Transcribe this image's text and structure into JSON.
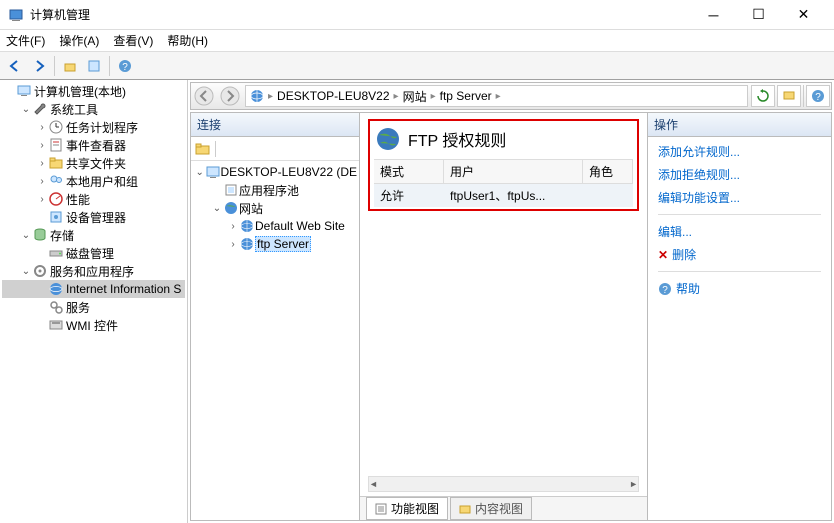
{
  "window": {
    "title": "计算机管理"
  },
  "menubar": [
    "文件(F)",
    "操作(A)",
    "查看(V)",
    "帮助(H)"
  ],
  "left_tree": [
    {
      "level": 0,
      "exp": "",
      "icon": "computer",
      "label": "计算机管理(本地)",
      "sel": false
    },
    {
      "level": 1,
      "exp": "v",
      "icon": "wrench",
      "label": "系统工具",
      "sel": false
    },
    {
      "level": 2,
      "exp": ">",
      "icon": "task",
      "label": "任务计划程序",
      "sel": false
    },
    {
      "level": 2,
      "exp": ">",
      "icon": "event",
      "label": "事件查看器",
      "sel": false
    },
    {
      "level": 2,
      "exp": ">",
      "icon": "share",
      "label": "共享文件夹",
      "sel": false
    },
    {
      "level": 2,
      "exp": ">",
      "icon": "users",
      "label": "本地用户和组",
      "sel": false
    },
    {
      "level": 2,
      "exp": ">",
      "icon": "perf",
      "label": "性能",
      "sel": false
    },
    {
      "level": 2,
      "exp": "",
      "icon": "device",
      "label": "设备管理器",
      "sel": false
    },
    {
      "level": 1,
      "exp": "v",
      "icon": "storage",
      "label": "存储",
      "sel": false
    },
    {
      "level": 2,
      "exp": "",
      "icon": "disk",
      "label": "磁盘管理",
      "sel": false
    },
    {
      "level": 1,
      "exp": "v",
      "icon": "services",
      "label": "服务和应用程序",
      "sel": false
    },
    {
      "level": 2,
      "exp": "",
      "icon": "iis",
      "label": "Internet Information S",
      "sel": true
    },
    {
      "level": 2,
      "exp": "",
      "icon": "svc",
      "label": "服务",
      "sel": false
    },
    {
      "level": 2,
      "exp": "",
      "icon": "wmi",
      "label": "WMI 控件",
      "sel": false
    }
  ],
  "breadcrumb": [
    "DESKTOP-LEU8V22",
    "网站",
    "ftp Server"
  ],
  "conn_panel": {
    "title": "连接",
    "tree": [
      {
        "level": 0,
        "exp": "v",
        "icon": "server",
        "label": "DESKTOP-LEU8V22 (DE",
        "sel": false
      },
      {
        "level": 1,
        "exp": "",
        "icon": "pool",
        "label": "应用程序池",
        "sel": false
      },
      {
        "level": 1,
        "exp": "v",
        "icon": "sites",
        "label": "网站",
        "sel": false
      },
      {
        "level": 2,
        "exp": ">",
        "icon": "globe",
        "label": "Default Web Site",
        "sel": false
      },
      {
        "level": 2,
        "exp": ">",
        "icon": "globe",
        "label": "ftp Server",
        "sel": true
      }
    ]
  },
  "center": {
    "title": "FTP 授权规则",
    "columns": {
      "mode": "模式",
      "user": "用户",
      "role": "角色"
    },
    "row": {
      "mode": "允许",
      "user": "ftpUser1、ftpUs...",
      "role": ""
    },
    "tabs": {
      "feature": "功能视图",
      "content": "内容视图"
    }
  },
  "actions": {
    "title": "操作",
    "items": [
      {
        "text": "添加允许规则...",
        "icon": ""
      },
      {
        "text": "添加拒绝规则...",
        "icon": ""
      },
      {
        "text": "编辑功能设置...",
        "icon": ""
      },
      {
        "sep": true
      },
      {
        "text": "编辑...",
        "icon": ""
      },
      {
        "text": "删除",
        "icon": "x"
      },
      {
        "sep": true
      },
      {
        "text": "帮助",
        "icon": "help"
      }
    ]
  }
}
